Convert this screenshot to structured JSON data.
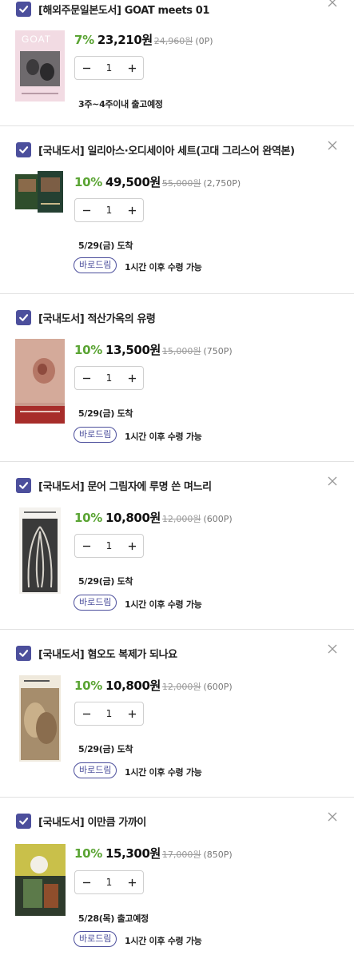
{
  "colors": {
    "accent": "#4c4f9c",
    "discount": "#5aa433",
    "divider": "#e2e2e2"
  },
  "items": [
    {
      "title": "[해외주문일본도서] GOAT meets 01",
      "rate": "7%",
      "price": "23,210원",
      "original": "24,960원",
      "points": "(0P)",
      "qty": "1",
      "shipping": "3주~4주이내 출고예정",
      "badge": "",
      "pickup": "",
      "cover_text": "GOAT"
    },
    {
      "title": "[국내도서] 일리아스·오디세이아 세트(고대 그리스어 완역본)",
      "rate": "10%",
      "price": "49,500원",
      "original": "55,000원",
      "points": "(2,750P)",
      "qty": "1",
      "shipping": "5/29(금) 도착",
      "badge": "바로드림",
      "pickup": "1시간 이후 수령 가능",
      "cover_text": ""
    },
    {
      "title": "[국내도서] 적산가옥의 유령",
      "rate": "10%",
      "price": "13,500원",
      "original": "15,000원",
      "points": "(750P)",
      "qty": "1",
      "shipping": "5/29(금) 도착",
      "badge": "바로드림",
      "pickup": "1시간 이후 수령 가능",
      "cover_text": ""
    },
    {
      "title": "[국내도서] 문어 그림자에 루명 쓴 며느리",
      "rate": "10%",
      "price": "10,800원",
      "original": "12,000원",
      "points": "(600P)",
      "qty": "1",
      "shipping": "5/29(금) 도착",
      "badge": "바로드림",
      "pickup": "1시간 이후 수령 가능",
      "cover_text": ""
    },
    {
      "title": "[국내도서] 혐오도 복제가 되나요",
      "rate": "10%",
      "price": "10,800원",
      "original": "12,000원",
      "points": "(600P)",
      "qty": "1",
      "shipping": "5/29(금) 도착",
      "badge": "바로드림",
      "pickup": "1시간 이후 수령 가능",
      "cover_text": ""
    },
    {
      "title": "[국내도서] 이만큼 가까이",
      "rate": "10%",
      "price": "15,300원",
      "original": "17,000원",
      "points": "(850P)",
      "qty": "1",
      "shipping": "5/28(목) 출고예정",
      "badge": "바로드림",
      "pickup": "1시간 이후 수령 가능",
      "cover_text": ""
    }
  ]
}
